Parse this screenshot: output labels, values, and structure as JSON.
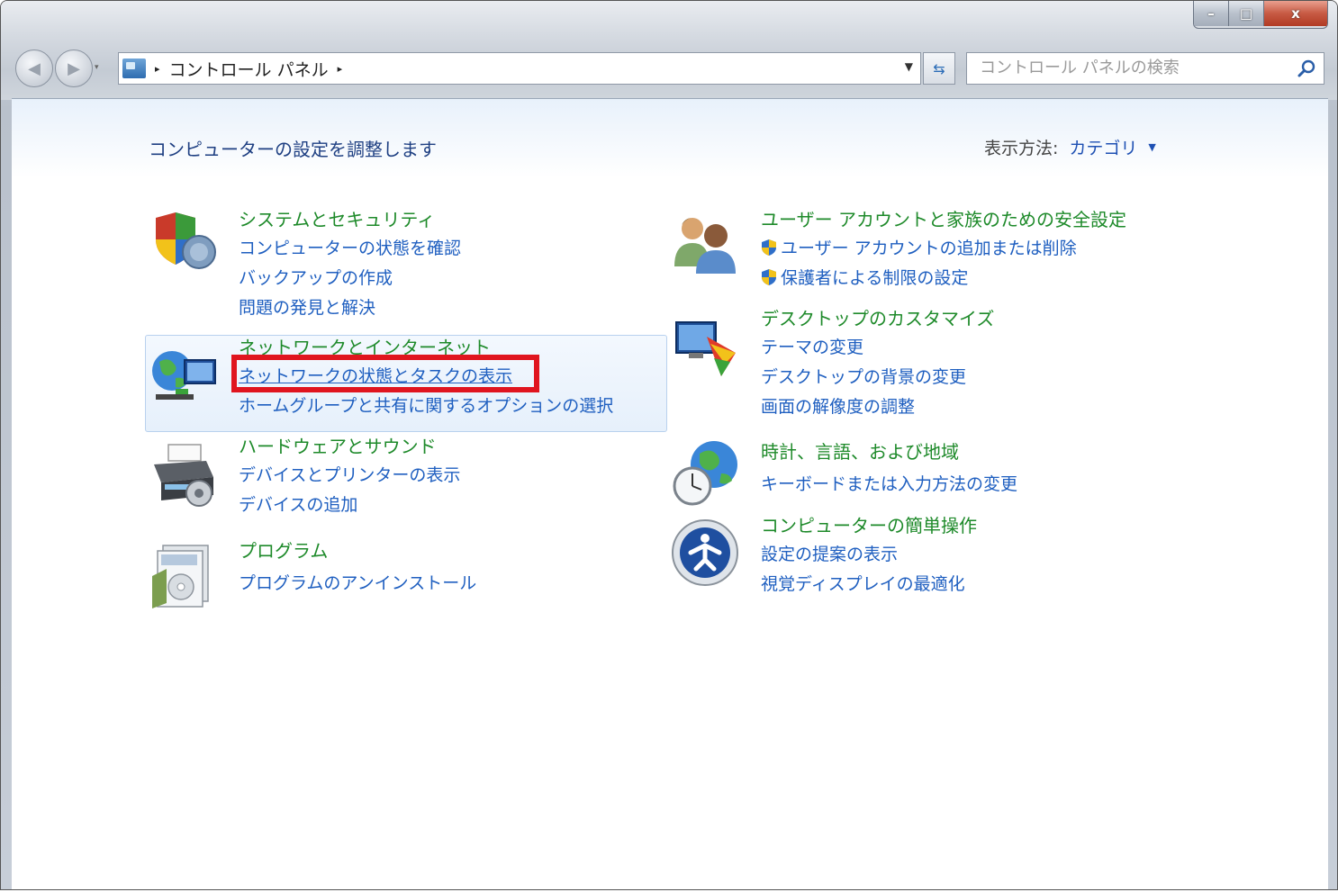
{
  "window": {
    "minimize": "–",
    "maximize": "□",
    "close": "x"
  },
  "toolbar": {
    "back": "◀",
    "forward": "▶",
    "nav_dropdown": "▾",
    "breadcrumb_sep": "▸",
    "breadcrumb": "コントロール パネル",
    "address_dropdown": "▼",
    "refresh": "⇆"
  },
  "search": {
    "placeholder": "コントロール パネルの検索"
  },
  "page": {
    "title": "コンピューターの設定を調整します",
    "view_label": "表示方法:",
    "view_value": "カテゴリ",
    "view_arrow": "▼"
  },
  "categories": {
    "system": {
      "title": "システムとセキュリティ",
      "links": [
        "コンピューターの状態を確認",
        "バックアップの作成",
        "問題の発見と解決"
      ]
    },
    "network": {
      "title": "ネットワークとインターネット",
      "links": [
        "ネットワークの状態とタスクの表示",
        "ホームグループと共有に関するオプションの選択"
      ]
    },
    "hardware": {
      "title": "ハードウェアとサウンド",
      "links": [
        "デバイスとプリンターの表示",
        "デバイスの追加"
      ]
    },
    "programs": {
      "title": "プログラム",
      "links": [
        "プログラムのアンインストール"
      ]
    },
    "users": {
      "title": "ユーザー アカウントと家族のための安全設定",
      "links": [
        "ユーザー アカウントの追加または削除",
        "保護者による制限の設定"
      ]
    },
    "appearance": {
      "title": "デスクトップのカスタマイズ",
      "links": [
        "テーマの変更",
        "デスクトップの背景の変更",
        "画面の解像度の調整"
      ]
    },
    "clock": {
      "title": "時計、言語、および地域",
      "links": [
        "キーボードまたは入力方法の変更"
      ]
    },
    "ease": {
      "title": "コンピューターの簡単操作",
      "links": [
        "設定の提案の表示",
        "視覚ディスプレイの最適化"
      ]
    }
  },
  "colors": {
    "title_green": "#1e8a2a",
    "link_blue": "#1f5fc0",
    "highlight_red": "#e0151f"
  }
}
